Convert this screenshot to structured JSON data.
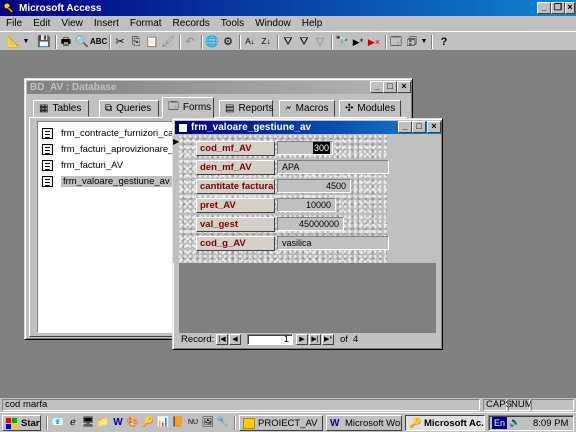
{
  "app": {
    "title": "Microsoft Access"
  },
  "menu": [
    "File",
    "Edit",
    "View",
    "Insert",
    "Format",
    "Records",
    "Tools",
    "Window",
    "Help"
  ],
  "db_window": {
    "title": "BD_AV : Database",
    "tabs": [
      "Tables",
      "Queries",
      "Forms",
      "Reports",
      "Macros",
      "Modules"
    ],
    "active_tab": "Forms",
    "items": [
      "frm_contracte_furnizori_calarasi",
      "frm_facturi_aprovizionare_AV",
      "frm_facturi_AV",
      "frm_valoare_gestiune_av"
    ],
    "selected_item": "frm_valoare_gestiune_av"
  },
  "form_window": {
    "title": "frm_valoare_gestiune_av",
    "fields": [
      {
        "label": "cod_mf_AV",
        "value": "300"
      },
      {
        "label": "den_mf_AV",
        "value": "APA"
      },
      {
        "label": "cantitate factura A",
        "value": "4500"
      },
      {
        "label": "pret_AV",
        "value": "10000"
      },
      {
        "label": "val_gest",
        "value": "45000000"
      },
      {
        "label": "cod_g_AV",
        "value": "vasilica"
      }
    ],
    "nav": {
      "label": "Record:",
      "current": "1",
      "of_label": "of",
      "total": "4"
    }
  },
  "statusbar": {
    "text": "cod marfa",
    "caps": "CAPS",
    "num": "NUM"
  },
  "taskbar": {
    "start": "Start",
    "tasks": [
      {
        "label": "PROIECT_AV",
        "icon": "folder-icon",
        "pressed": false
      },
      {
        "label": "Microsoft Word ...",
        "icon": "word-icon",
        "pressed": false
      },
      {
        "label": "Microsoft Ac...",
        "icon": "access-icon",
        "pressed": true
      }
    ],
    "language": "En",
    "time": "8:09 PM"
  }
}
